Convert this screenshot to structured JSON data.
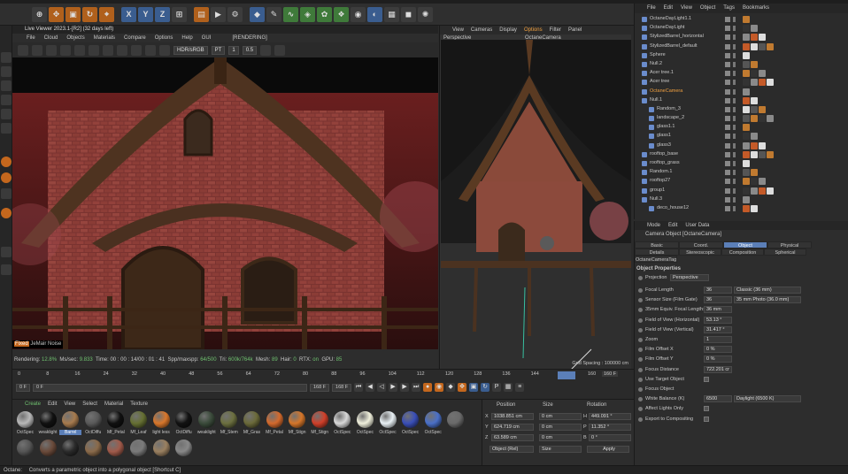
{
  "colors": {
    "accent": "#5b7fb8",
    "orange": "#c4671d",
    "green": "#6fc16f",
    "bg": "#2b2b2b",
    "render_sky": "#8a2a2a"
  },
  "toolbar": {
    "buttons": [
      "select-icon",
      "move-icon",
      "scale-icon",
      "rotate-icon",
      "transform-icon",
      "X",
      "Y",
      "Z",
      "coord-icon",
      "render-region-icon",
      "render-view-icon",
      "render-settings-icon",
      "cube-icon",
      "pen-icon",
      "spline-icon",
      "subdivision-icon",
      "cloner-icon",
      "deformer-icon",
      "field-icon",
      "scene-icon",
      "camera-icon",
      "light-icon"
    ]
  },
  "live_viewer": {
    "title": "Live Viewer 2023.1-[R2] (32 days left)",
    "menu": [
      "File",
      "Cloud",
      "Objects",
      "Materials",
      "Compare",
      "Options",
      "Help",
      "GUI"
    ],
    "state": "[RENDERING]",
    "color_space": "HDR/sRGB",
    "kernel": "PT",
    "value_a": "1",
    "value_b": "0.5",
    "overlay_tag": "JeMair Noise",
    "overlay_prefix": "Fixed",
    "stats": {
      "rendering_label": "Rendering:",
      "rendering": "12.8%",
      "ms_label": "Ms/sec:",
      "ms": "9.833",
      "time_label": "Time:",
      "time": "00 : 00 : 14/00 : 01 : 41",
      "spp_label": "Spp/maxspp:",
      "spp": "64/500",
      "tri_label": "Tri:",
      "tri": "600k/764k",
      "mesh_label": "Mesh:",
      "mesh": "89",
      "hair_label": "Hair:",
      "hair": "0",
      "rtx_label": "RTX:",
      "rtx": "on",
      "gpu_label": "GPU:",
      "gpu": "85"
    }
  },
  "perspective": {
    "menu": [
      "View",
      "Cameras",
      "Display",
      "Options",
      "Filter",
      "Panel"
    ],
    "active_menu": "Options",
    "view_name": "Perspective",
    "camera_name": "OctaneCamera",
    "grid_spacing": "Grid Spacing : 100000 cm"
  },
  "object_manager": {
    "menu": [
      "File",
      "Edit",
      "View",
      "Object",
      "Tags",
      "Bookmarks"
    ],
    "objects": [
      {
        "name": "OctaneDayLight1.1",
        "indent": 0
      },
      {
        "name": "OctaneDayLight",
        "indent": 0
      },
      {
        "name": "StylizedBarrel_horizontal",
        "indent": 0
      },
      {
        "name": "StylizedBarrel_default",
        "indent": 0
      },
      {
        "name": "Sphere",
        "indent": 0
      },
      {
        "name": "Null.2",
        "indent": 0
      },
      {
        "name": "Acer tree.1",
        "indent": 0
      },
      {
        "name": "Acer tree",
        "indent": 0
      },
      {
        "name": "OctaneCamera",
        "indent": 0,
        "selected": true
      },
      {
        "name": "Null.1",
        "indent": 0
      },
      {
        "name": "Random_3",
        "indent": 1
      },
      {
        "name": "landscape_2",
        "indent": 1
      },
      {
        "name": "glass1.1",
        "indent": 1
      },
      {
        "name": "glass1",
        "indent": 1
      },
      {
        "name": "glass3",
        "indent": 1
      },
      {
        "name": "rooftop_base",
        "indent": 0
      },
      {
        "name": "rooftop_grass",
        "indent": 0
      },
      {
        "name": "Random.1",
        "indent": 0
      },
      {
        "name": "rooftop27",
        "indent": 0
      },
      {
        "name": "group1",
        "indent": 0
      },
      {
        "name": "Null.3",
        "indent": 0
      },
      {
        "name": "deco_house12",
        "indent": 1
      }
    ]
  },
  "attributes": {
    "menu": [
      "Mode",
      "Edit",
      "User Data"
    ],
    "object_title": "Camera Object [OctaneCamera]",
    "tabs": [
      "Basic",
      "Coord.",
      "Object",
      "Physical",
      "Details",
      "Stereoscopic",
      "Composition",
      "Spherical",
      "OctaneCameraTag"
    ],
    "active_tab": "Object",
    "section": "Object Properties",
    "projection_label": "Projection",
    "projection": "Perspective",
    "rows": [
      {
        "label": "Focal Length",
        "value": "36",
        "dropdown": "Classic (36 mm)"
      },
      {
        "label": "Sensor Size (Film Gate)",
        "value": "36",
        "dropdown": "35 mm Photo (36.0 mm)"
      },
      {
        "label": "35mm Equiv. Focal Length:",
        "value": "36 mm",
        "dropdown": ""
      },
      {
        "label": "Field of View (Horizontal)",
        "value": "53.13 °",
        "dropdown": ""
      },
      {
        "label": "Field of View (Vertical)",
        "value": "31.417 °",
        "dropdown": ""
      },
      {
        "label": "Zoom",
        "value": "1",
        "dropdown": ""
      },
      {
        "label": "Film Offset X",
        "value": "0 %",
        "dropdown": ""
      },
      {
        "label": "Film Offset Y",
        "value": "0 %",
        "dropdown": ""
      },
      {
        "label": "Focus Distance",
        "value": "722.201 cr",
        "dropdown": ""
      },
      {
        "label": "Use Target Object",
        "value": "",
        "dropdown": ""
      },
      {
        "label": "Focus Object",
        "value": "",
        "dropdown": ""
      },
      {
        "label": "White Balance (K)",
        "value": "6500",
        "dropdown": "Daylight (6500 K)"
      },
      {
        "label": "Affect Lights Only",
        "value": "",
        "dropdown": ""
      },
      {
        "label": "Export to Compositing",
        "value": "",
        "dropdown": ""
      }
    ]
  },
  "timeline": {
    "ticks": [
      "0",
      "8",
      "16",
      "24",
      "32",
      "40",
      "48",
      "56",
      "64",
      "72",
      "80",
      "88",
      "96",
      "104",
      "112",
      "120",
      "128",
      "136",
      "144",
      "152",
      "160"
    ],
    "start": "0 F",
    "current": "0 F",
    "end_a": "168 F",
    "end_b": "168 F",
    "frame": "160 F"
  },
  "materials": {
    "menu": [
      "Create",
      "Edit",
      "View",
      "Select",
      "Material",
      "Texture"
    ],
    "items": [
      {
        "name": "OctSpec",
        "color": "#b8b8b8"
      },
      {
        "name": "weaklight",
        "color": "#111111"
      },
      {
        "name": "Barrel",
        "color": "#a77b4e",
        "highlight": true
      },
      {
        "name": "OctDiffu",
        "color": "#5a5a5a"
      },
      {
        "name": "Mf_Petal",
        "color": "#101010"
      },
      {
        "name": "Mf_Leaf",
        "color": "#667033"
      },
      {
        "name": "light less",
        "color": "#d9772b"
      },
      {
        "name": "OctDiffu",
        "color": "#121212"
      },
      {
        "name": "weaklight",
        "color": "#3b4b3b"
      },
      {
        "name": "Mf_Stem",
        "color": "#6c7040"
      },
      {
        "name": "Mf_Gras",
        "color": "#6b6a3a"
      },
      {
        "name": "Mf_Petal",
        "color": "#d46a2d"
      },
      {
        "name": "Mf_Stign",
        "color": "#d5762a"
      },
      {
        "name": "Mf_Stign",
        "color": "#d0402a"
      },
      {
        "name": "OctSpec",
        "color": "#d8d8d8"
      },
      {
        "name": "OctSpec",
        "color": "#f0f0dc"
      },
      {
        "name": "OctSpec",
        "color": "#e8f0f4"
      },
      {
        "name": "OctSpec",
        "color": "#3a4fb8"
      },
      {
        "name": "OctSpec",
        "color": "#4a70c8"
      },
      {
        "name": "",
        "color": "#6a6a6a"
      },
      {
        "name": "",
        "color": "#555555"
      },
      {
        "name": "",
        "color": "#6a4a3a"
      },
      {
        "name": "",
        "color": "#2a2a2a"
      },
      {
        "name": "",
        "color": "#8a6a4a"
      },
      {
        "name": "",
        "color": "#a05a4a"
      },
      {
        "name": "",
        "color": "#7a7a7a"
      },
      {
        "name": "",
        "color": "#9a8060"
      },
      {
        "name": "",
        "color": "#888888"
      }
    ]
  },
  "coordinates": {
    "headers": [
      "Position",
      "Size",
      "Rotation"
    ],
    "rows": [
      {
        "axis": "X",
        "pos": "1038.851 cm",
        "size": "0 cm",
        "rot_axis": "H",
        "rot": "449.091 °"
      },
      {
        "axis": "Y",
        "pos": "624.719 cm",
        "size": "0 cm",
        "rot_axis": "P",
        "rot": "11.352 °"
      },
      {
        "axis": "Z",
        "pos": "63.589 cm",
        "size": "0 cm",
        "rot_axis": "B",
        "rot": "0 °"
      }
    ],
    "mode": "Object (Rel)",
    "size_mode": "Size",
    "apply": "Apply"
  },
  "status": {
    "app": "Octane:",
    "message": "Converts a parametric object into a polygonal object [Shortcut C]"
  }
}
